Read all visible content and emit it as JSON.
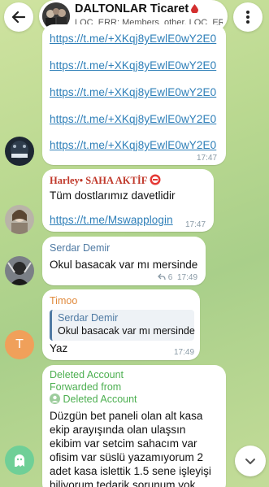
{
  "header": {
    "title": "DALTONLAR Ticaret",
    "subtitle": "LOC_ERR: Members_other, LOC_ER"
  },
  "messages": {
    "m1": {
      "links": [
        "https://t.me/+XKqj8yEwlE0wY2E0",
        "https://t.me/+XKqj8yEwlE0wY2E0",
        "https://t.me/+XKqj8yEwlE0wY2E0",
        "https://t.me/+XKqj8yEwlE0wY2E0",
        "https://t.me/+XKqj8yEwlE0wY2E0"
      ],
      "time": "17:47"
    },
    "m2": {
      "sender": "Harley• SAHA AKTİF",
      "text": "Tüm dostlarımız davetlidir",
      "link": "https://t.me/Mswapplogin",
      "time": "17:47"
    },
    "m3": {
      "sender": "Serdar Demir",
      "text": "Okul basacak var mı mersinde",
      "replies": "6",
      "time": "17:49"
    },
    "m4": {
      "sender": "Timoo",
      "avatar_letter": "T",
      "quote_sender": "Serdar Demir",
      "quote_text": "Okul basacak var mı mersinde",
      "text": "Yaz",
      "time": "17:49"
    },
    "m5": {
      "sender": "Deleted Account",
      "forwarded_label": "Forwarded from",
      "forwarded_name": "Deleted Account",
      "lines": [
        "Düzgün  bet paneli  olan alt kasa",
        "ekip arayışında olan ulaşsın",
        "ekibim var setcim  sahacım  var",
        "ofisim  var süslü  yazamıyorum 2",
        "adet kasa islettik 1.5 sene işleyişi",
        "biliyorum tedarik  sorunum  yok"
      ]
    }
  },
  "colors": {
    "link": "#2e7fb8",
    "sender_red": "#c0392b",
    "sender_blue": "#4f7aa3",
    "sender_orange": "#e08a3c",
    "sender_green": "#4caf50",
    "time_gray": "#8a9aa6"
  },
  "icons": {
    "back": "arrow-left-icon",
    "menu": "kebab-menu-icon",
    "scroll": "chevron-down-icon",
    "reply": "reply-arrow-icon",
    "ghost": "ghost-avatar-icon"
  }
}
